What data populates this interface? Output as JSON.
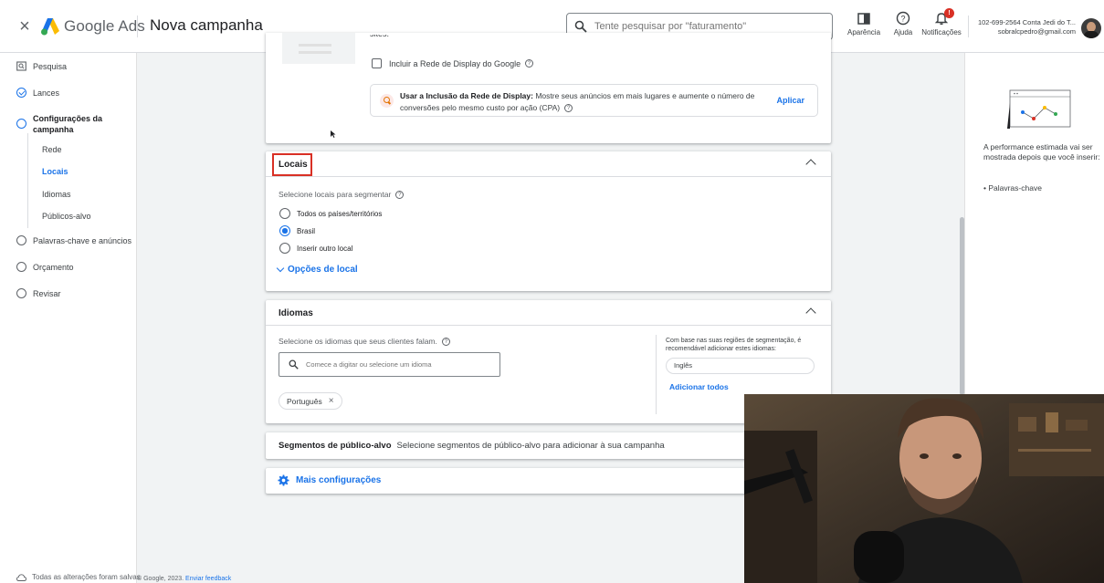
{
  "topbar": {
    "close_glyph": "×",
    "brand": "Google Ads",
    "page_title": "Nova campanha",
    "search_placeholder": "Tente pesquisar por \"faturamento\"",
    "tools": {
      "appearance": "Aparência",
      "help": "Ajuda",
      "notifications": "Notificações",
      "notif_badge": "!"
    },
    "account_line1": "102-699-2564 Conta Jedi do T...",
    "account_line2": "sobralcpedro@gmail.com"
  },
  "sidebar": {
    "pesquisa": "Pesquisa",
    "lances": "Lances",
    "config": "Configurações da campanha",
    "sub": {
      "rede": "Rede",
      "locais": "Locais",
      "idiomas": "Idiomas",
      "publicos": "Públicos-alvo"
    },
    "palavras": "Palavras-chave e anúncios",
    "orcamento": "Orçamento",
    "revisar": "Revisar",
    "saved": "Todas as alterações foram salvas"
  },
  "footer": {
    "copyright": "© Google, 2023.",
    "feedback": "Enviar feedback"
  },
  "display": {
    "include_label": "Incluir a Rede de Display do Google",
    "promo_bold": "Usar a Inclusão da Rede de Display:",
    "promo_rest": " Mostre seus anúncios em mais lugares e aumente o número de conversões pelo mesmo custo por ação (CPA)",
    "apply": "Aplicar"
  },
  "locais": {
    "title": "Locais",
    "subtitle": "Selecione locais para segmentar",
    "options": [
      "Todos os países/territórios",
      "Brasil",
      "Inserir outro local"
    ],
    "selected_index": 1,
    "more": "Opções de local"
  },
  "idiomas": {
    "title": "Idiomas",
    "subtitle": "Selecione os idiomas que seus clientes falam.",
    "input_placeholder": "Comece a digitar ou selecione um idioma",
    "chip": "Português",
    "rec_text": "Com base nas suas regiões de segmentação, é recomendável adicionar estes idiomas:",
    "rec_chip": "Inglês",
    "add_all": "Adicionar todos"
  },
  "segmentos": {
    "title": "Segmentos de público-alvo",
    "desc": "Selecione segmentos de público-alvo para adicionar à sua campanha"
  },
  "more_settings": "Mais configurações",
  "rpanel": {
    "perf_text": "A performance estimada vai ser mostrada depois que você inserir:",
    "bullet": "• Palavras-chave"
  },
  "colors": {
    "accent": "#1a73e8",
    "highlight": "#d93025"
  }
}
